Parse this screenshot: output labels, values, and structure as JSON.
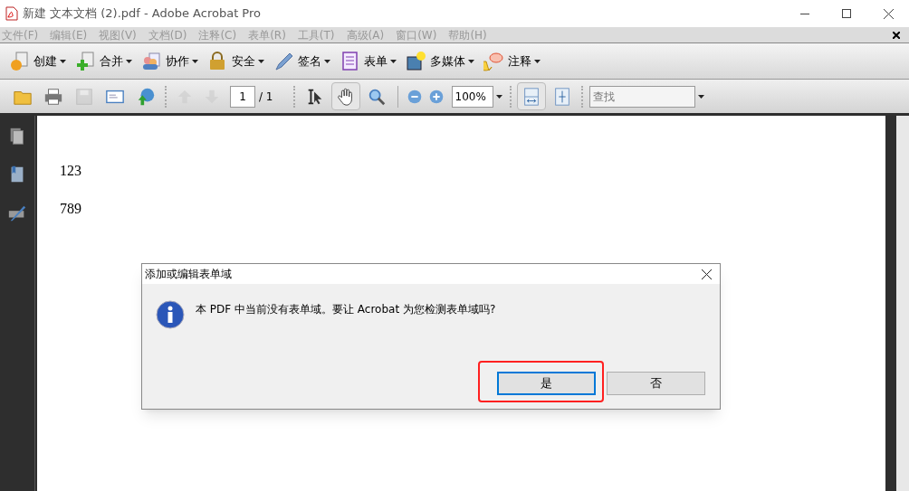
{
  "window": {
    "title": "新建 文本文档 (2).pdf - Adobe Acrobat Pro"
  },
  "menu": [
    {
      "label": "文件(F)",
      "disabled": true
    },
    {
      "label": "编辑(E)",
      "disabled": true
    },
    {
      "label": "视图(V)",
      "disabled": true
    },
    {
      "label": "文档(D)",
      "disabled": true
    },
    {
      "label": "注释(C)",
      "disabled": true
    },
    {
      "label": "表单(R)",
      "disabled": true
    },
    {
      "label": "工具(T)",
      "disabled": true
    },
    {
      "label": "高级(A)",
      "disabled": true
    },
    {
      "label": "窗口(W)",
      "disabled": true
    },
    {
      "label": "帮助(H)",
      "disabled": true
    }
  ],
  "task_buttons": [
    {
      "kind": "create",
      "label": "创建"
    },
    {
      "kind": "combine",
      "label": "合并"
    },
    {
      "kind": "collaborate",
      "label": "协作"
    },
    {
      "kind": "secure",
      "label": "安全"
    },
    {
      "kind": "sign",
      "label": "签名"
    },
    {
      "kind": "forms",
      "label": "表单"
    },
    {
      "kind": "multimedia",
      "label": "多媒体"
    },
    {
      "kind": "comment",
      "label": "注释"
    }
  ],
  "file_tools": [
    {
      "kind": "open",
      "disabled": false
    },
    {
      "kind": "print",
      "disabled": false
    },
    {
      "kind": "save",
      "disabled": true
    },
    {
      "kind": "email",
      "disabled": false
    },
    {
      "kind": "upload",
      "disabled": false
    }
  ],
  "nav_tools": [
    {
      "kind": "up",
      "disabled": true
    },
    {
      "kind": "down",
      "disabled": true
    }
  ],
  "page_field": {
    "value": "1",
    "total": "/ 1"
  },
  "view_tools": [
    {
      "kind": "select",
      "selected": false
    },
    {
      "kind": "hand",
      "selected": true
    },
    {
      "kind": "marquee",
      "selected": false
    }
  ],
  "zoom_tools": [
    {
      "kind": "zoom-out"
    },
    {
      "kind": "zoom-in"
    }
  ],
  "zoom_field": {
    "value": "100%"
  },
  "fit_tools": [
    {
      "kind": "fit-width",
      "selected": true
    },
    {
      "kind": "fit-page",
      "selected": false
    }
  ],
  "search_field": {
    "placeholder": "查找"
  },
  "sidebar": [
    {
      "kind": "pages"
    },
    {
      "kind": "bookmarks"
    },
    {
      "kind": "signatures"
    }
  ],
  "document": {
    "lines": [
      "123",
      "789"
    ]
  },
  "dialog": {
    "title": "添加或编辑表单域",
    "message": "本 PDF 中当前没有表单域。要让 Acrobat 为您检测表单域吗?",
    "buttons": [
      {
        "label": "是",
        "default": true,
        "highlighted": true
      },
      {
        "label": "否",
        "default": false,
        "highlighted": false
      }
    ]
  }
}
